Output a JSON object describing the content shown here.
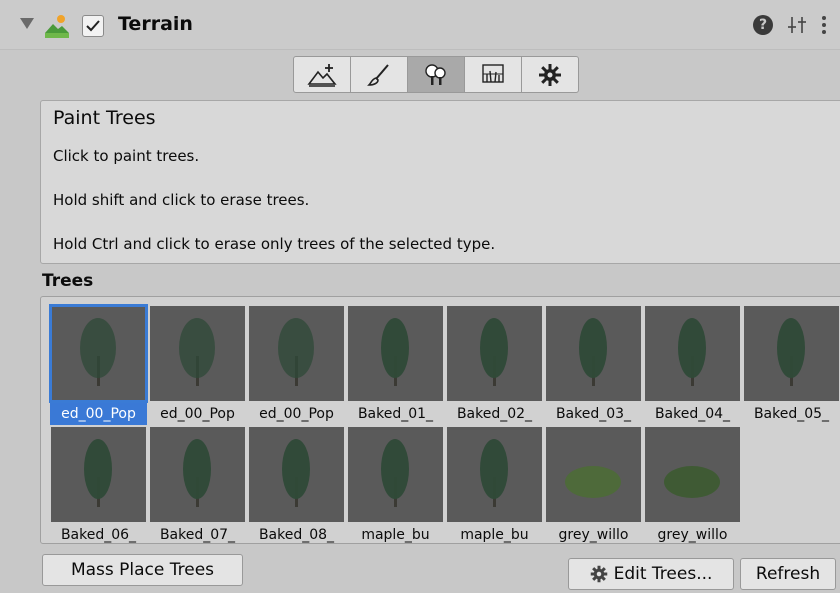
{
  "header": {
    "title": "Terrain",
    "enabled": true,
    "help_glyph": "?"
  },
  "tools": [
    {
      "icon": "raise-terrain-icon",
      "active": false
    },
    {
      "icon": "paint-brush-icon",
      "active": false
    },
    {
      "icon": "paint-trees-icon",
      "active": true
    },
    {
      "icon": "paint-details-icon",
      "active": false
    },
    {
      "icon": "settings-gear-icon",
      "active": false
    }
  ],
  "helpbox": {
    "title": "Paint Trees",
    "lines": [
      "Click to paint trees.",
      "Hold shift and click to erase trees.",
      "Hold Ctrl and click to erase only trees of the selected type."
    ]
  },
  "trees": {
    "label": "Trees",
    "items": [
      {
        "label": "ed_00_Pop",
        "selected": true
      },
      {
        "label": "ed_00_Pop",
        "selected": false
      },
      {
        "label": "ed_00_Pop",
        "selected": false
      },
      {
        "label": "Baked_01_",
        "selected": false
      },
      {
        "label": "Baked_02_",
        "selected": false
      },
      {
        "label": "Baked_03_",
        "selected": false
      },
      {
        "label": "Baked_04_",
        "selected": false
      },
      {
        "label": "Baked_05_",
        "selected": false
      },
      {
        "label": "Baked_06_",
        "selected": false
      },
      {
        "label": "Baked_07_",
        "selected": false
      },
      {
        "label": "Baked_08_",
        "selected": false
      },
      {
        "label": "maple_bu",
        "selected": false
      },
      {
        "label": "maple_bu",
        "selected": false
      },
      {
        "label": "grey_willo",
        "selected": false
      },
      {
        "label": "grey_willo",
        "selected": false
      }
    ]
  },
  "buttons": {
    "mass_place": "Mass Place Trees",
    "edit_trees": "Edit Trees...",
    "refresh": "Refresh"
  },
  "colors": {
    "selection": "#3a79d6",
    "thumb_bg": "#5a5a5a",
    "foliage": "#2f4a38"
  }
}
